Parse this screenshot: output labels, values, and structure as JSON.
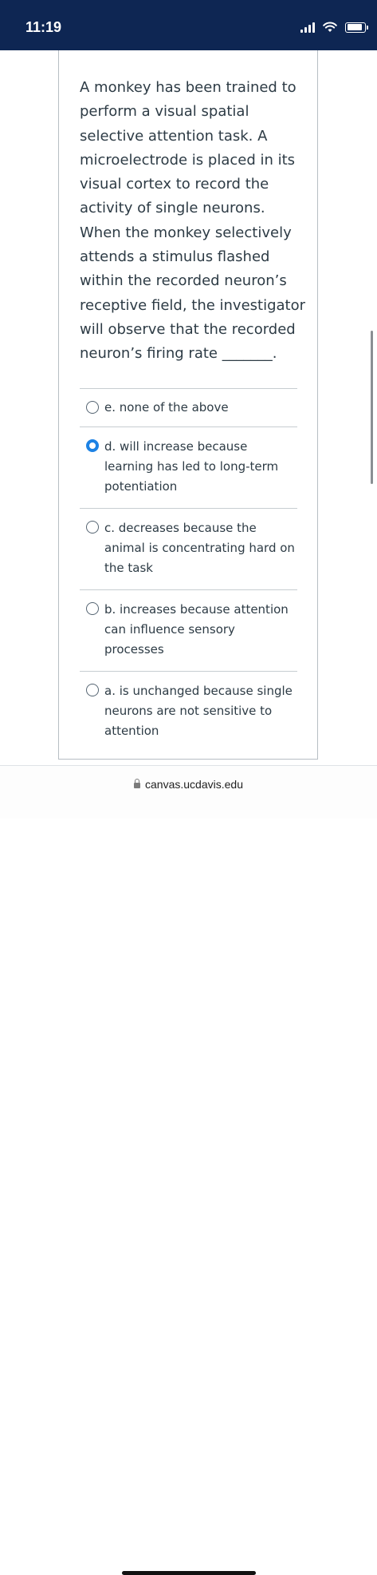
{
  "status_bar": {
    "time": "11:19"
  },
  "question": {
    "text": "A monkey has been trained to perform a visual spatial selective attention task. A microelectrode is placed in its visual cortex to record the activity of single neurons. When the monkey selectively attends a stimulus flashed within the recorded neuron’s receptive field, the investigator will observe that the recorded neuron’s firing rate _______."
  },
  "answers": [
    {
      "label": "e. none of the above",
      "selected": false
    },
    {
      "label": "d. will increase because learning has led to long-term potentiation",
      "selected": true
    },
    {
      "label": "c. decreases because the animal is concentrating hard on the task",
      "selected": false
    },
    {
      "label": "b. increases because attention can influence sensory processes",
      "selected": false
    },
    {
      "label": "a. is unchanged because single neurons are not sensitive to attention",
      "selected": false
    }
  ],
  "browser": {
    "url": "canvas.ucdavis.edu"
  },
  "colors": {
    "status_bar": "#0e2653",
    "selected_radio": "#1d82e4"
  }
}
